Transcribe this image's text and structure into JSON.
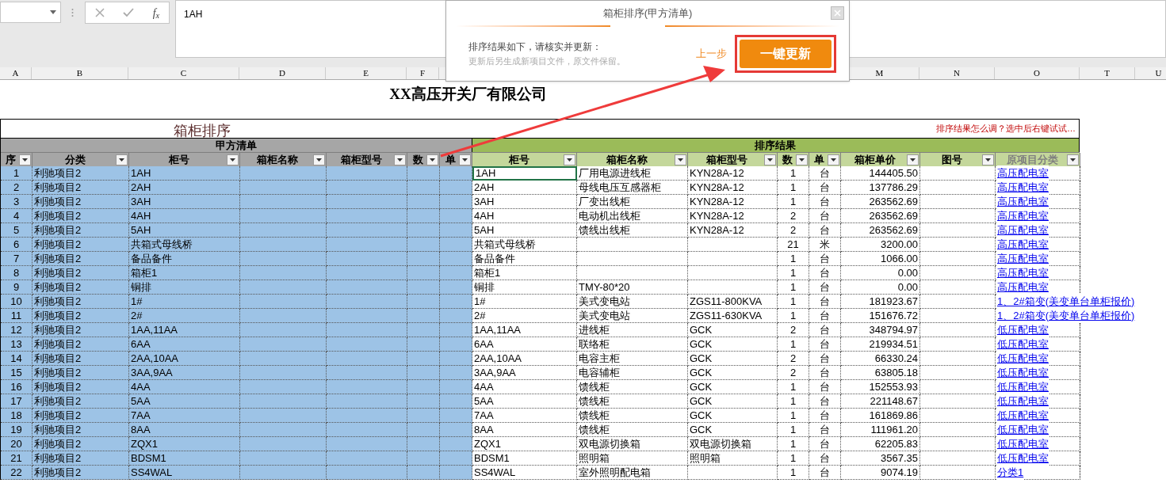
{
  "formula_bar": {
    "function_label": "f$_{x}$",
    "formula": "1AH"
  },
  "column_letters": [
    "A",
    "B",
    "C",
    "D",
    "E",
    "F",
    "M",
    "N",
    "O",
    "T",
    "U"
  ],
  "sheet_title": "XX高压开关厂有限公司",
  "table": {
    "title": "箱柜排序",
    "hint": "排序结果怎么调？选中后右键试试…",
    "left_group": "甲方清单",
    "right_group": "排序结果",
    "left_columns": [
      "序",
      "分类",
      "柜号",
      "箱柜名称",
      "箱柜型号",
      "数",
      "单"
    ],
    "right_columns": [
      "柜号",
      "箱柜名称",
      "箱柜型号",
      "数",
      "单",
      "箱柜单价",
      "图号",
      "原项目分类"
    ],
    "left_rows": [
      {
        "seq": "1",
        "category": "利驰项目2",
        "cabinet": "1AH",
        "selected": true
      },
      {
        "seq": "2",
        "category": "利驰项目2",
        "cabinet": "2AH",
        "selected": true
      },
      {
        "seq": "3",
        "category": "利驰项目2",
        "cabinet": "3AH",
        "selected": true
      },
      {
        "seq": "4",
        "category": "利驰项目2",
        "cabinet": "4AH",
        "selected": true
      },
      {
        "seq": "5",
        "category": "利驰项目2",
        "cabinet": "5AH",
        "selected": true
      },
      {
        "seq": "6",
        "category": "利驰项目2",
        "cabinet": "共箱式母线桥",
        "selected": true
      },
      {
        "seq": "7",
        "category": "利驰项目2",
        "cabinet": "备品备件",
        "selected": true
      },
      {
        "seq": "8",
        "category": "利驰项目2",
        "cabinet": "箱柜1",
        "selected": true
      },
      {
        "seq": "9",
        "category": "利驰项目2",
        "cabinet": "铜排",
        "selected": true
      },
      {
        "seq": "10",
        "category": "利驰项目2",
        "cabinet": "1#",
        "selected": true
      },
      {
        "seq": "11",
        "category": "利驰项目2",
        "cabinet": "2#",
        "selected": true
      },
      {
        "seq": "12",
        "category": "利驰项目2",
        "cabinet": "1AA,11AA",
        "selected": true
      },
      {
        "seq": "13",
        "category": "利驰项目2",
        "cabinet": "6AA",
        "selected": true
      },
      {
        "seq": "14",
        "category": "利驰项目2",
        "cabinet": "2AA,10AA",
        "selected": true
      },
      {
        "seq": "15",
        "category": "利驰项目2",
        "cabinet": "3AA,9AA",
        "selected": true
      },
      {
        "seq": "16",
        "category": "利驰项目2",
        "cabinet": "4AA",
        "selected": true
      },
      {
        "seq": "17",
        "category": "利驰项目2",
        "cabinet": "5AA",
        "selected": true
      },
      {
        "seq": "18",
        "category": "利驰项目2",
        "cabinet": "7AA",
        "selected": true
      },
      {
        "seq": "19",
        "category": "利驰项目2",
        "cabinet": "8AA",
        "selected": true
      },
      {
        "seq": "20",
        "category": "利驰项目2",
        "cabinet": "ZQX1",
        "selected": true
      },
      {
        "seq": "21",
        "category": "利驰项目2",
        "cabinet": "BDSM1",
        "selected": true
      },
      {
        "seq": "22",
        "category": "利驰项目2",
        "cabinet": "SS4WAL",
        "selected": true
      }
    ],
    "right_rows": [
      {
        "cabinet": "1AH",
        "name": "厂用电源进线柜",
        "model": "KYN28A-12",
        "qty": "1",
        "unit": "台",
        "price": "144405.50",
        "category": "高压配电室",
        "active": true
      },
      {
        "cabinet": "2AH",
        "name": "母线电压互感器柜",
        "model": "KYN28A-12",
        "qty": "1",
        "unit": "台",
        "price": "137786.29",
        "category": "高压配电室",
        "active": false
      },
      {
        "cabinet": "3AH",
        "name": "厂变出线柜",
        "model": "KYN28A-12",
        "qty": "1",
        "unit": "台",
        "price": "263562.69",
        "category": "高压配电室",
        "active": false
      },
      {
        "cabinet": "4AH",
        "name": "电动机出线柜",
        "model": "KYN28A-12",
        "qty": "2",
        "unit": "台",
        "price": "263562.69",
        "category": "高压配电室",
        "active": false
      },
      {
        "cabinet": "5AH",
        "name": "馈线出线柜",
        "model": "KYN28A-12",
        "qty": "2",
        "unit": "台",
        "price": "263562.69",
        "category": "高压配电室",
        "active": false
      },
      {
        "cabinet": "共箱式母线桥",
        "qty": "21",
        "unit": "米",
        "price": "3200.00",
        "category": "高压配电室",
        "active": false
      },
      {
        "cabinet": "备品备件",
        "qty": "1",
        "unit": "台",
        "price": "1066.00",
        "category": "高压配电室",
        "active": false
      },
      {
        "cabinet": "箱柜1",
        "qty": "1",
        "unit": "台",
        "price": "0.00",
        "category": "高压配电室",
        "active": false
      },
      {
        "cabinet": "铜排",
        "name": "TMY-80*20",
        "qty": "1",
        "unit": "台",
        "price": "0.00",
        "category": "高压配电室",
        "active": false
      },
      {
        "cabinet": "1#",
        "name": "美式变电站",
        "model": "ZGS11-800KVA",
        "qty": "1",
        "unit": "台",
        "price": "181923.67",
        "category": "1、2#箱变(美变单台单柜报价)",
        "active": false
      },
      {
        "cabinet": "2#",
        "name": "美式变电站",
        "model": "ZGS11-630KVA",
        "qty": "1",
        "unit": "台",
        "price": "151676.72",
        "category": "1、2#箱变(美变单台单柜报价)",
        "active": false
      },
      {
        "cabinet": "1AA,11AA",
        "name": "进线柜",
        "model": "GCK",
        "qty": "2",
        "unit": "台",
        "price": "348794.97",
        "category": "低压配电室",
        "active": false
      },
      {
        "cabinet": "6AA",
        "name": "联络柜",
        "model": "GCK",
        "qty": "1",
        "unit": "台",
        "price": "219934.51",
        "category": "低压配电室",
        "active": false
      },
      {
        "cabinet": "2AA,10AA",
        "name": "电容主柜",
        "model": "GCK",
        "qty": "2",
        "unit": "台",
        "price": "66330.24",
        "category": "低压配电室",
        "active": false
      },
      {
        "cabinet": "3AA,9AA",
        "name": "电容辅柜",
        "model": "GCK",
        "qty": "2",
        "unit": "台",
        "price": "63805.18",
        "category": "低压配电室",
        "active": false
      },
      {
        "cabinet": "4AA",
        "name": "馈线柜",
        "model": "GCK",
        "qty": "1",
        "unit": "台",
        "price": "152553.93",
        "category": "低压配电室",
        "active": false
      },
      {
        "cabinet": "5AA",
        "name": "馈线柜",
        "model": "GCK",
        "qty": "1",
        "unit": "台",
        "price": "221148.67",
        "category": "低压配电室",
        "active": false
      },
      {
        "cabinet": "7AA",
        "name": "馈线柜",
        "model": "GCK",
        "qty": "1",
        "unit": "台",
        "price": "161869.86",
        "category": "低压配电室",
        "active": false
      },
      {
        "cabinet": "8AA",
        "name": "馈线柜",
        "model": "GCK",
        "qty": "1",
        "unit": "台",
        "price": "111961.20",
        "category": "低压配电室",
        "active": false
      },
      {
        "cabinet": "ZQX1",
        "name": "双电源切换箱",
        "model": "双电源切换箱",
        "qty": "1",
        "unit": "台",
        "price": "62205.83",
        "category": "低压配电室",
        "active": false
      },
      {
        "cabinet": "BDSM1",
        "name": "照明箱",
        "model": "照明箱",
        "qty": "1",
        "unit": "台",
        "price": "3567.35",
        "category": "低压配电室",
        "active": false
      },
      {
        "cabinet": "SS4WAL",
        "name": "室外照明配电箱",
        "qty": "1",
        "unit": "台",
        "price": "9074.19",
        "category": "分类1",
        "active": false
      }
    ]
  },
  "dialog": {
    "title": "箱柜排序(甲方清单)",
    "message": "排序结果如下，请核实并更新：",
    "note": "更新后另生成新项目文件，原文件保留。",
    "back_link": "上一步",
    "primary_button": "一键更新"
  }
}
